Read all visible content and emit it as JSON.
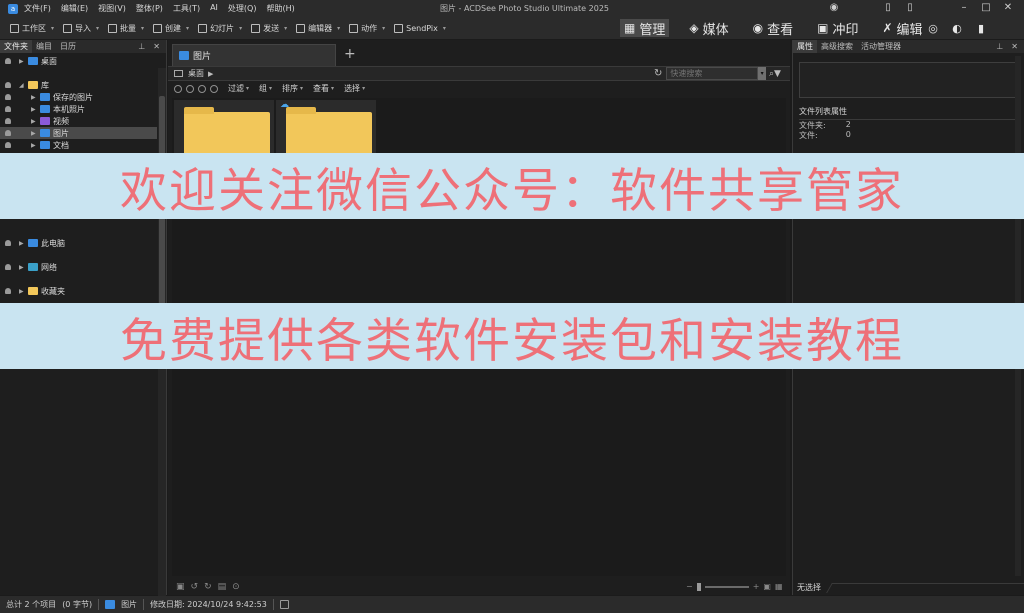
{
  "window": {
    "title": "图片 - ACDSee Photo Studio Ultimate 2025"
  },
  "menu": [
    "文件(F)",
    "编辑(E)",
    "视图(V)",
    "整体(P)",
    "工具(T)",
    "AI",
    "处理(Q)",
    "帮助(H)"
  ],
  "toolbar": {
    "items": [
      "工作区",
      "导入",
      "批量",
      "创建",
      "幻灯片",
      "发送",
      "编辑器",
      "动作",
      "SendPix"
    ],
    "modes": [
      {
        "label": "管理",
        "icon": "grid-icon"
      },
      {
        "label": "媒体",
        "icon": "media-icon"
      },
      {
        "label": "查看",
        "icon": "eye-icon"
      },
      {
        "label": "冲印",
        "icon": "develop-icon"
      },
      {
        "label": "编辑",
        "icon": "edit-icon"
      }
    ],
    "tool_icons": [
      "365-icon",
      "dashboard-icon",
      "stats-icon"
    ]
  },
  "left_panel": {
    "tabs": [
      "文件夹",
      "编目",
      "日历"
    ],
    "tree": [
      {
        "label": "桌面",
        "color": "#3a8be0"
      },
      {
        "label": "库",
        "color": "#f2c75a"
      },
      {
        "label": "保存的图片",
        "color": "#3a8be0"
      },
      {
        "label": "本机照片",
        "color": "#3a8be0"
      },
      {
        "label": "视频",
        "color": "#8a5ad8"
      },
      {
        "label": "图片",
        "color": "#3a8be0"
      },
      {
        "label": "文档",
        "color": "#3a8be0"
      },
      {
        "label": "此电脑",
        "color": "#3a8be0"
      },
      {
        "label": "网络",
        "color": "#3aa0c8"
      },
      {
        "label": "收藏夹",
        "color": "#f2c75a"
      }
    ]
  },
  "center": {
    "tab_label": "图片",
    "address": "桌面",
    "search_placeholder": "快速搜索",
    "view_menu": [
      "过滤",
      "组",
      "排序",
      "查看",
      "选择"
    ]
  },
  "right_panel": {
    "tabs": [
      "属性",
      "高级搜索",
      "活动管理器"
    ],
    "section_title": "文件列表属性",
    "props": [
      {
        "label": "文件夹:",
        "value": "2"
      },
      {
        "label": "文件:",
        "value": "0"
      }
    ],
    "footer": "无选择"
  },
  "status": {
    "total": "总计 2 个项目",
    "size": "(0 字节)",
    "location": "图片",
    "modified": "修改日期: 2024/10/24 9:42:53"
  },
  "overlay": {
    "line1": "欢迎关注微信公众号：软件共享管家",
    "line2": "免费提供各类软件安装包和安装教程"
  },
  "colors": {
    "accent": "#3a8be0",
    "folder": "#f2c75a",
    "banner_bg": "#c9e4f1",
    "banner_text": "#ee7078"
  }
}
